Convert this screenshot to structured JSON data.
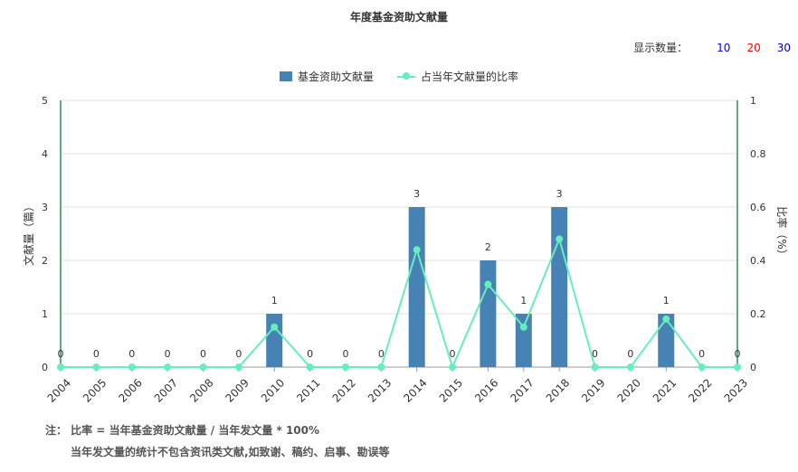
{
  "title": "年度基金资助文献量",
  "display_count": {
    "label": "显示数量：",
    "options": [
      "10",
      "20",
      "30"
    ],
    "colors": [
      "#0000ff",
      "#ff0000",
      "#0000aa"
    ]
  },
  "legend": {
    "bar": "基金资助文献量",
    "line": "占当年文献量的比率"
  },
  "colors": {
    "bar": "#4682b4",
    "line": "#66eebb",
    "left_axis": "#2e8b57",
    "right_axis": "#2e8b57"
  },
  "chart_data": {
    "type": "bar",
    "categories": [
      "2004",
      "2005",
      "2006",
      "2007",
      "2008",
      "2009",
      "2010",
      "2011",
      "2012",
      "2013",
      "2014",
      "2015",
      "2016",
      "2017",
      "2018",
      "2019",
      "2020",
      "2021",
      "2022",
      "2023"
    ],
    "series": [
      {
        "name": "基金资助文献量",
        "type": "bar",
        "axis": "left",
        "values": [
          0,
          0,
          0,
          0,
          0,
          0,
          1,
          0,
          0,
          0,
          3,
          0,
          2,
          1,
          3,
          0,
          0,
          1,
          0,
          0
        ]
      },
      {
        "name": "占当年文献量的比率",
        "type": "line",
        "axis": "right",
        "values": [
          0,
          0,
          0,
          0,
          0,
          0,
          0.15,
          0,
          0,
          0,
          0.44,
          0,
          0.31,
          0.15,
          0.48,
          0,
          0,
          0.18,
          0,
          0
        ]
      }
    ],
    "ylabel": "文献量（篇）",
    "y2label": "比率（%）",
    "ylim": [
      0,
      5
    ],
    "y2lim": [
      0,
      1
    ],
    "yticks": [
      "0",
      "1",
      "2",
      "3",
      "4",
      "5"
    ],
    "y2ticks": [
      "0",
      "0.2",
      "0.4",
      "0.6",
      "0.8",
      "1"
    ],
    "grid": true,
    "legend_position": "top"
  },
  "notes": {
    "line1": "注： 比率 = 当年基金资助文献量 / 当年发文量 * 100%",
    "line2": "当年发文量的统计不包含资讯类文献,如致谢、稿约、启事、勘误等"
  }
}
